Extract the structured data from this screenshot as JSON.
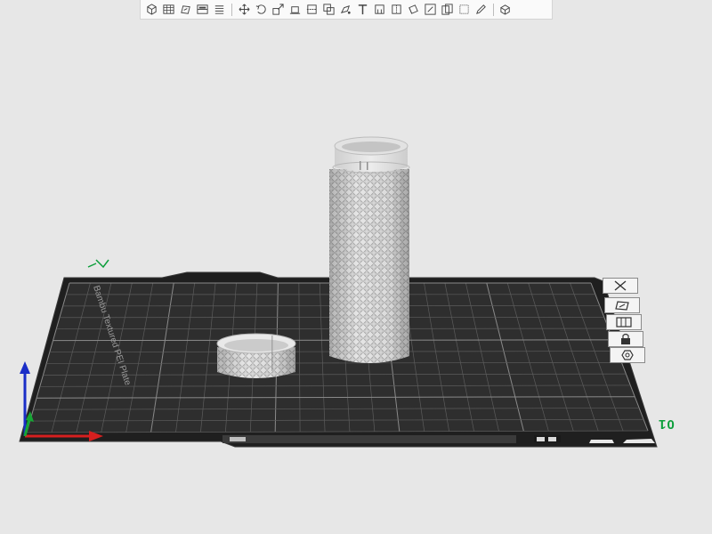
{
  "app": {
    "view": "3D Prepare"
  },
  "toolbar": {
    "buttons": [
      {
        "name": "add-object-icon"
      },
      {
        "name": "arrange-grid-icon"
      },
      {
        "name": "orient-icon"
      },
      {
        "name": "split-view-icon"
      },
      {
        "name": "list-icon"
      },
      {
        "sep": true
      },
      {
        "name": "move-icon"
      },
      {
        "name": "rotate-icon"
      },
      {
        "name": "scale-icon"
      },
      {
        "name": "lay-on-face-icon"
      },
      {
        "name": "cut-icon"
      },
      {
        "name": "mesh-boolean-icon"
      },
      {
        "name": "paint-icon"
      },
      {
        "name": "text-tool-icon"
      },
      {
        "name": "support-paint-icon"
      },
      {
        "name": "seam-icon"
      },
      {
        "name": "measure-icon"
      },
      {
        "name": "color-paint-icon"
      },
      {
        "name": "copy-icon"
      },
      {
        "name": "fuzzy-skin-icon"
      },
      {
        "name": "pen-icon"
      },
      {
        "sep": true
      },
      {
        "name": "assembly-icon"
      }
    ]
  },
  "plate": {
    "label": "Bambu Textured PEI Plate",
    "number": "01",
    "colors": {
      "surface": "#2e2e2e",
      "grid": "#6a6a6a",
      "accent_green": "#0b9e3a"
    }
  },
  "side_toolbar": {
    "buttons": [
      {
        "name": "delete-plate-icon"
      },
      {
        "name": "auto-orient-icon"
      },
      {
        "name": "arrange-icon"
      },
      {
        "name": "lock-plate-icon"
      },
      {
        "name": "plate-settings-icon"
      }
    ]
  },
  "objects": [
    {
      "name": "knurled-tube",
      "color": "#d9d9d9"
    },
    {
      "name": "knurled-ring",
      "color": "#d9d9d9"
    }
  ],
  "axes": {
    "x_color": "#d61f1f",
    "y_color": "#16a534",
    "z_color": "#1a2ec7"
  }
}
